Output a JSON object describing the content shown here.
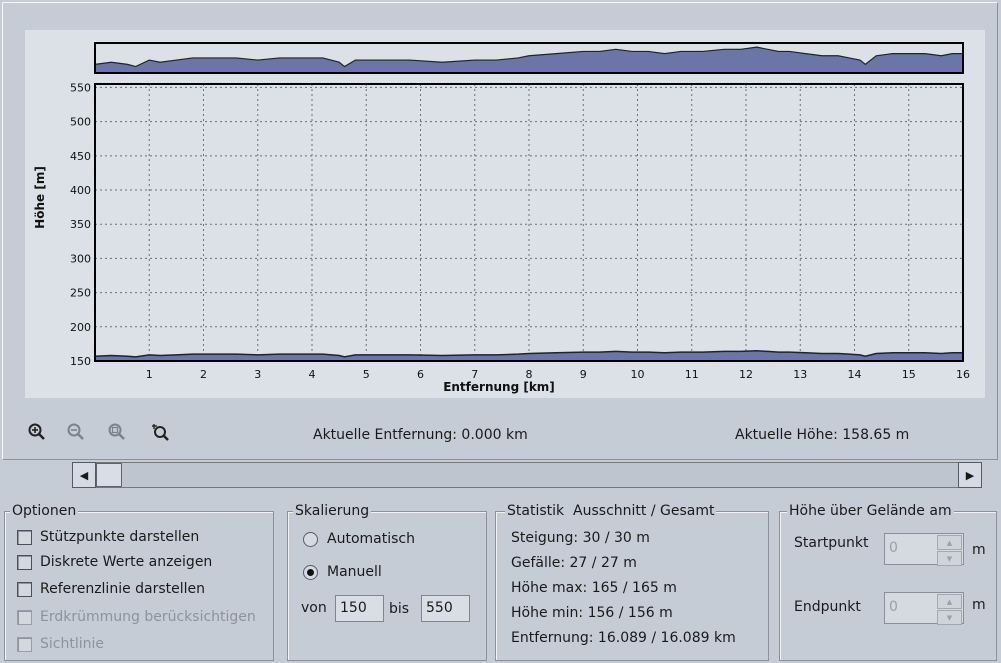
{
  "chart_data": {
    "type": "area",
    "overview": {
      "x": [
        0,
        0.3,
        0.6,
        0.75,
        1.0,
        1.2,
        1.5,
        1.8,
        2.2,
        2.6,
        3.0,
        3.4,
        3.8,
        4.2,
        4.5,
        4.6,
        4.8,
        5.2,
        5.8,
        6.4,
        7.0,
        7.4,
        7.8,
        8.0,
        8.5,
        9.0,
        9.3,
        9.6,
        9.9,
        10.2,
        10.5,
        10.8,
        11.2,
        11.6,
        11.9,
        12.2,
        12.4,
        12.6,
        12.8,
        13.1,
        13.4,
        13.7,
        13.9,
        14.1,
        14.2,
        14.4,
        14.7,
        15.0,
        15.3,
        15.6,
        15.8,
        16.0
      ],
      "y": [
        157,
        158,
        157,
        156,
        159,
        158,
        159,
        160,
        160,
        160,
        159,
        160,
        160,
        160,
        158,
        156,
        159,
        159,
        159,
        158,
        159,
        159,
        160,
        161,
        162,
        163,
        163,
        164,
        163,
        163,
        162,
        163,
        163,
        164,
        164,
        165,
        164,
        163,
        163,
        162,
        161,
        161,
        160,
        159,
        157,
        161,
        162,
        162,
        162,
        161,
        162,
        162
      ]
    },
    "series": [
      {
        "x": [
          0,
          0.3,
          0.6,
          0.75,
          1.0,
          1.2,
          1.5,
          1.8,
          2.2,
          2.6,
          3.0,
          3.4,
          3.8,
          4.2,
          4.5,
          4.6,
          4.8,
          5.2,
          5.8,
          6.4,
          7.0,
          7.4,
          7.8,
          8.0,
          8.5,
          9.0,
          9.3,
          9.6,
          9.9,
          10.2,
          10.5,
          10.8,
          11.2,
          11.6,
          11.9,
          12.2,
          12.4,
          12.6,
          12.8,
          13.1,
          13.4,
          13.7,
          13.9,
          14.1,
          14.2,
          14.4,
          14.7,
          15.0,
          15.3,
          15.6,
          15.8,
          16.0
        ],
        "y": [
          157,
          158,
          157,
          156,
          159,
          158,
          159,
          160,
          160,
          160,
          159,
          160,
          160,
          160,
          158,
          156,
          159,
          159,
          159,
          158,
          159,
          159,
          160,
          161,
          162,
          163,
          163,
          164,
          163,
          163,
          162,
          163,
          163,
          164,
          164,
          165,
          164,
          163,
          163,
          162,
          161,
          161,
          160,
          159,
          157,
          161,
          162,
          162,
          162,
          161,
          162,
          162
        ]
      }
    ],
    "xlabel": "Entfernung [km]",
    "ylabel": "Höhe [m]",
    "xlim": [
      0,
      16
    ],
    "ylim": [
      150,
      555
    ],
    "x_ticks": [
      "1",
      "2",
      "3",
      "4",
      "5",
      "6",
      "7",
      "8",
      "9",
      "10",
      "11",
      "12",
      "13",
      "14",
      "15",
      "16"
    ],
    "y_ticks": [
      "150",
      "200",
      "250",
      "300",
      "350",
      "400",
      "450",
      "500",
      "550"
    ],
    "grid": true,
    "fill_color": "#6b75a8",
    "line_color": "#1b2240"
  },
  "toolbar": {
    "icons": [
      "zoom-in-icon",
      "zoom-out-icon",
      "zoom-window-icon",
      "zoom-reset-icon"
    ]
  },
  "readouts": {
    "distance": "Aktuelle Entfernung: 0.000 km",
    "height": "Aktuelle Höhe: 158.65 m"
  },
  "scrollbar": {
    "left_icon": "arrow-left-icon",
    "right_icon": "arrow-right-icon"
  },
  "options": {
    "title": "Optionen",
    "items": [
      {
        "label": "Stützpunkte darstellen",
        "checked": false,
        "enabled": true
      },
      {
        "label": "Diskrete Werte anzeigen",
        "checked": false,
        "enabled": true
      },
      {
        "label": "Referenzlinie darstellen",
        "checked": false,
        "enabled": true
      },
      {
        "label": "Erdkrümmung berücksichtigen",
        "checked": false,
        "enabled": false
      },
      {
        "label": "Sichtlinie",
        "checked": false,
        "enabled": false
      }
    ]
  },
  "scaling": {
    "title": "Skalierung",
    "auto_label": "Automatisch",
    "manual_label": "Manuell",
    "selected": "Manuell",
    "from_label": "von",
    "from_value": "150",
    "to_label": "bis",
    "to_value": "550"
  },
  "stats": {
    "title": "Statistik",
    "subtitle": "Ausschnitt / Gesamt",
    "lines": [
      "Steigung: 30 / 30 m",
      "Gefälle: 27 / 27 m",
      "Höhe max: 165 / 165 m",
      "Höhe min: 156 / 156 m",
      "Entfernung: 16.089 / 16.089 km"
    ]
  },
  "height_over_ground": {
    "title": "Höhe über Gelände am",
    "start_label": "Startpunkt",
    "start_value": "0",
    "start_unit": "m",
    "end_label": "Endpunkt",
    "end_value": "0",
    "end_unit": "m"
  }
}
